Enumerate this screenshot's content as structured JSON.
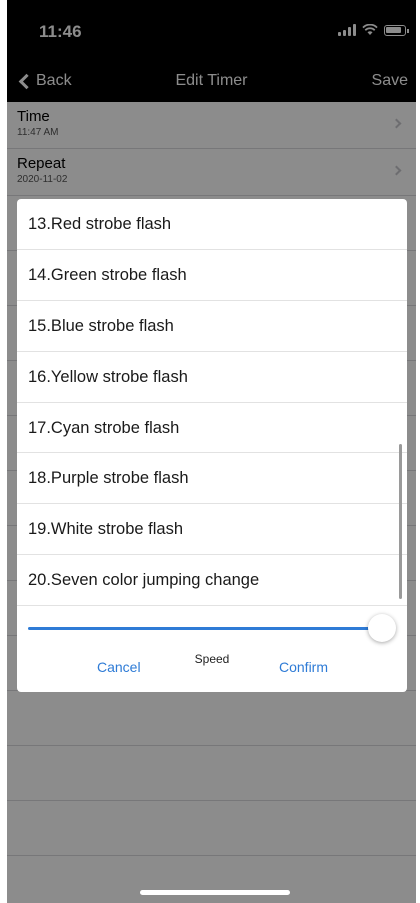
{
  "status_bar": {
    "time": "11:46",
    "icons": [
      "signal-icon",
      "wifi-icon",
      "battery-icon"
    ]
  },
  "nav": {
    "back_label": "Back",
    "title": "Edit Timer",
    "save_label": "Save"
  },
  "settings": [
    {
      "label": "Time",
      "value": "11:47 AM"
    },
    {
      "label": "Repeat",
      "value": "2020-11-02"
    }
  ],
  "modal": {
    "options": [
      "13.Red strobe flash",
      "14.Green strobe flash",
      "15.Blue strobe flash",
      "16.Yellow strobe flash",
      "17.Cyan strobe flash",
      "18.Purple strobe flash",
      "19.White strobe flash",
      "20.Seven color jumping change"
    ],
    "speed_value_fraction": 1.0,
    "speed_label": "Speed",
    "cancel_label": "Cancel",
    "confirm_label": "Confirm"
  },
  "colors": {
    "accent": "#2e7bd6",
    "nav_background": "#000000",
    "overlay": "rgba(0,0,0,0.45)"
  }
}
